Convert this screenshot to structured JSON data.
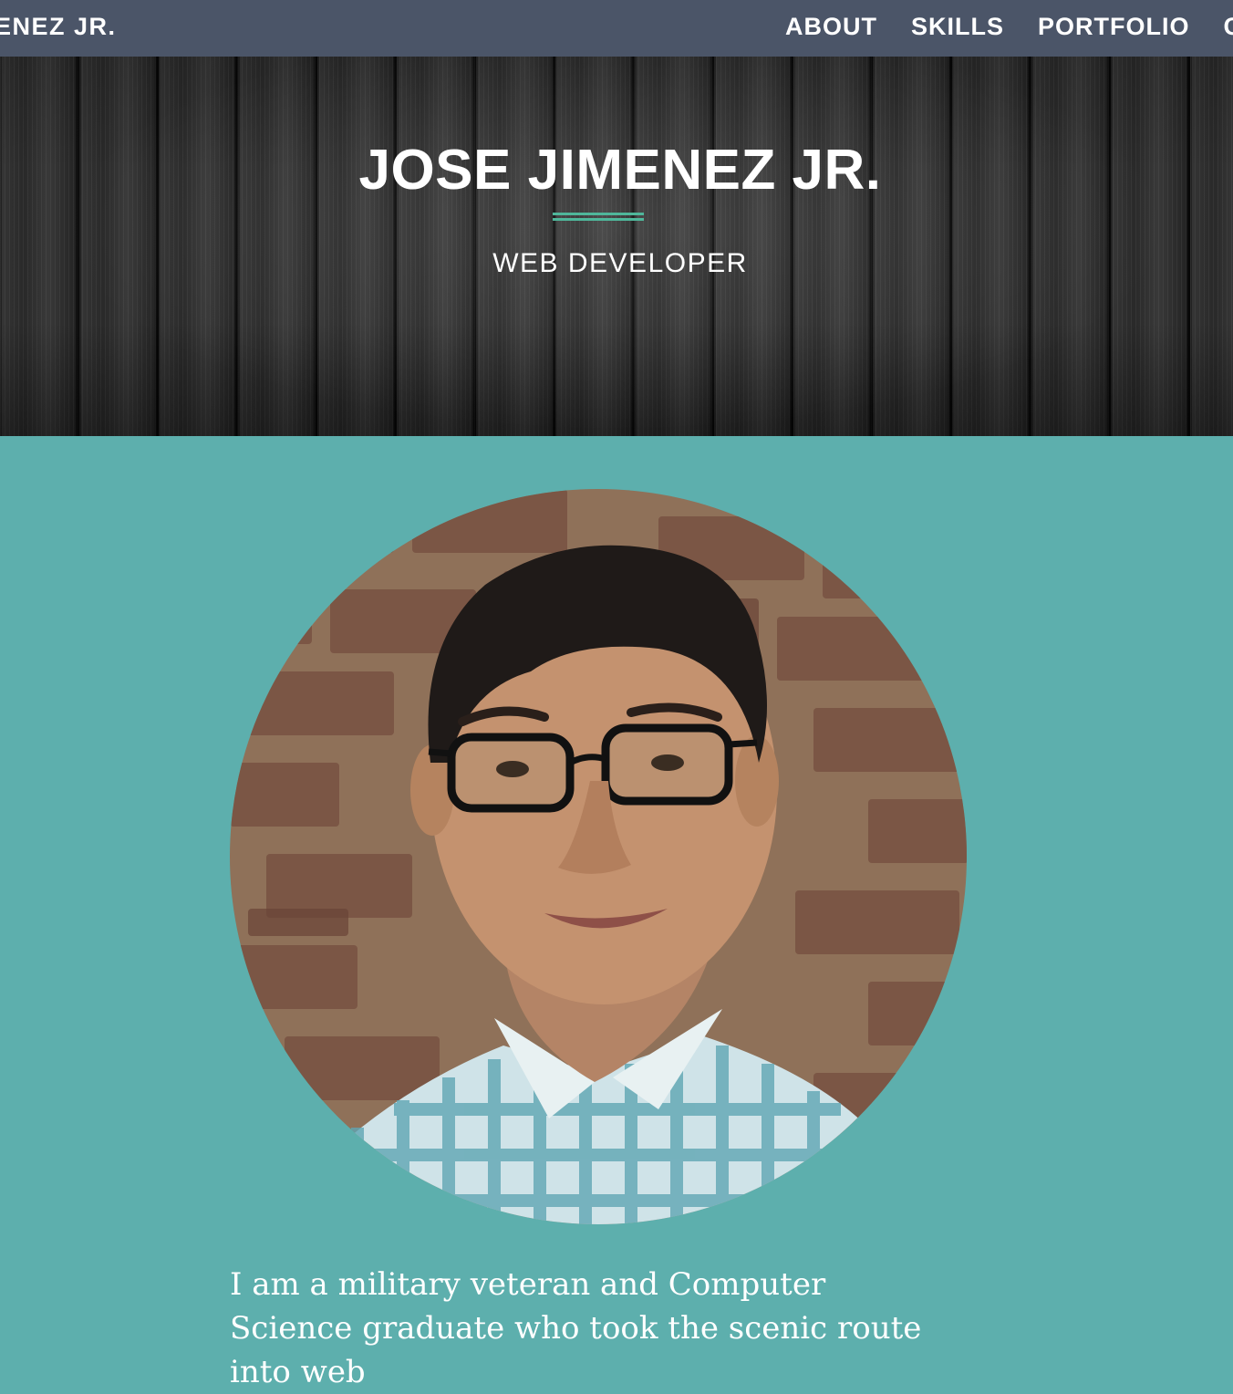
{
  "nav": {
    "brand": "ENEZ JR.",
    "links": [
      "ABOUT",
      "SKILLS",
      "PORTFOLIO",
      "C"
    ]
  },
  "hero": {
    "title": "JOSE JIMENEZ JR.",
    "subtitle": "WEB DEVELOPER"
  },
  "about": {
    "text": "I am a military veteran and Computer Science graduate who took the scenic route into web"
  },
  "colors": {
    "navbar": "#4b5568",
    "accent": "#4fb69a",
    "about_background": "#5dafad",
    "hero_wood": "#2e2e2e"
  }
}
